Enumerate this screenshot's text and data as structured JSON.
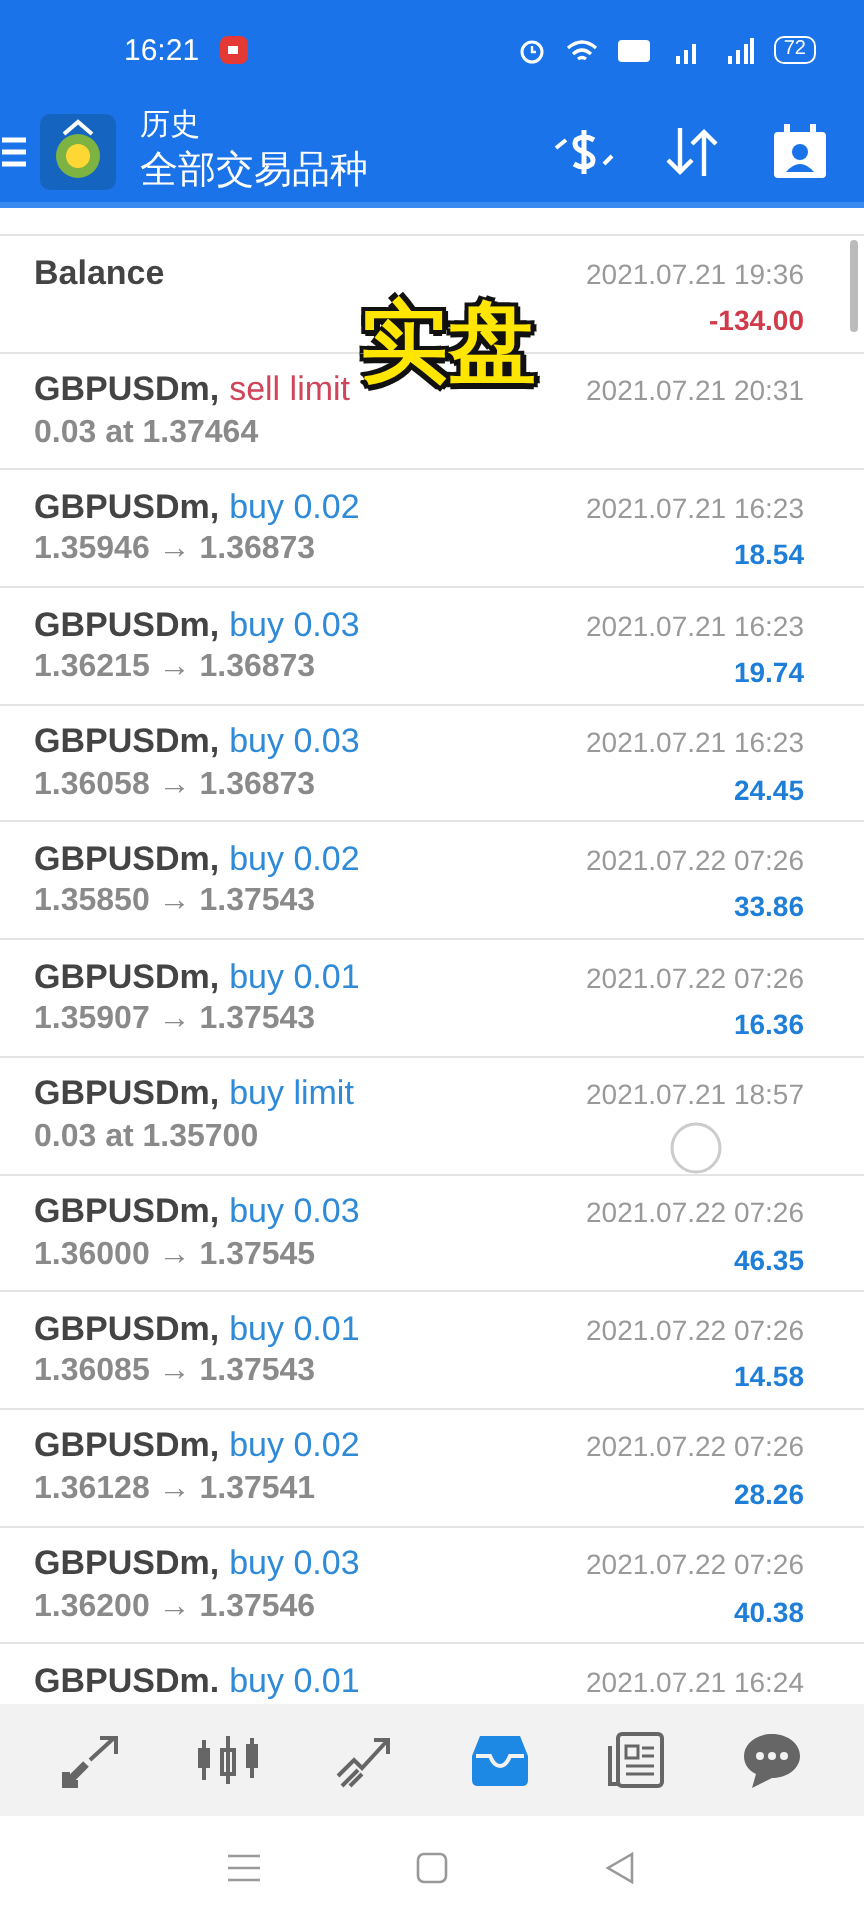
{
  "status_bar": {
    "time": "16:21",
    "battery": "72"
  },
  "app_bar": {
    "title": "历史",
    "subtitle": "全部交易品种"
  },
  "overlay_caption": "实盘",
  "rows": [
    {
      "kind": "balance",
      "symbol": "Balance",
      "date": "2021.07.21 19:36",
      "profit": {
        "text": "-134.00",
        "color": "#d03a4a"
      }
    },
    {
      "kind": "order",
      "symbol": "GBPUSDm,",
      "action": {
        "text": "sell limit",
        "color": "#d0455a"
      },
      "detail": "0.03 at 1.37464",
      "date": "2021.07.21 20:31"
    },
    {
      "kind": "order",
      "symbol": "GBPUSDm,",
      "action": {
        "text": "buy 0.02",
        "color": "#2f8ad8"
      },
      "detail": "1.35946 → 1.36873",
      "date": "2021.07.21 16:23",
      "profit": {
        "text": "18.54",
        "color": "#1f7fd8"
      }
    },
    {
      "kind": "order",
      "symbol": "GBPUSDm,",
      "action": {
        "text": "buy 0.03",
        "color": "#2f8ad8"
      },
      "detail": "1.36215 → 1.36873",
      "date": "2021.07.21 16:23",
      "profit": {
        "text": "19.74",
        "color": "#1f7fd8"
      }
    },
    {
      "kind": "order",
      "symbol": "GBPUSDm,",
      "action": {
        "text": "buy 0.03",
        "color": "#2f8ad8"
      },
      "detail": "1.36058 → 1.36873",
      "date": "2021.07.21 16:23",
      "profit": {
        "text": "24.45",
        "color": "#1f7fd8"
      }
    },
    {
      "kind": "order",
      "symbol": "GBPUSDm,",
      "action": {
        "text": "buy 0.02",
        "color": "#2f8ad8"
      },
      "detail": "1.35850 → 1.37543",
      "date": "2021.07.22 07:26",
      "profit": {
        "text": "33.86",
        "color": "#1f7fd8"
      }
    },
    {
      "kind": "order",
      "symbol": "GBPUSDm,",
      "action": {
        "text": "buy 0.01",
        "color": "#2f8ad8"
      },
      "detail": "1.35907 → 1.37543",
      "date": "2021.07.22 07:26",
      "profit": {
        "text": "16.36",
        "color": "#1f7fd8"
      }
    },
    {
      "kind": "order",
      "symbol": "GBPUSDm,",
      "action": {
        "text": "buy limit",
        "color": "#2f8ad8"
      },
      "detail": "0.03 at 1.35700",
      "date": "2021.07.21 18:57",
      "loading": true
    },
    {
      "kind": "order",
      "symbol": "GBPUSDm,",
      "action": {
        "text": "buy 0.03",
        "color": "#2f8ad8"
      },
      "detail": "1.36000 → 1.37545",
      "date": "2021.07.22 07:26",
      "profit": {
        "text": "46.35",
        "color": "#1f7fd8"
      }
    },
    {
      "kind": "order",
      "symbol": "GBPUSDm,",
      "action": {
        "text": "buy 0.01",
        "color": "#2f8ad8"
      },
      "detail": "1.36085 → 1.37543",
      "date": "2021.07.22 07:26",
      "profit": {
        "text": "14.58",
        "color": "#1f7fd8"
      }
    },
    {
      "kind": "order",
      "symbol": "GBPUSDm,",
      "action": {
        "text": "buy 0.02",
        "color": "#2f8ad8"
      },
      "detail": "1.36128 → 1.37541",
      "date": "2021.07.22 07:26",
      "profit": {
        "text": "28.26",
        "color": "#1f7fd8"
      }
    },
    {
      "kind": "order",
      "symbol": "GBPUSDm,",
      "action": {
        "text": "buy 0.03",
        "color": "#2f8ad8"
      },
      "detail": "1.36200 → 1.37546",
      "date": "2021.07.22 07:26",
      "profit": {
        "text": "40.38",
        "color": "#1f7fd8"
      }
    },
    {
      "kind": "order",
      "symbol": "GBPUSDm.",
      "action": {
        "text": "buy 0.01",
        "color": "#2f8ad8"
      },
      "date": "2021.07.21 16:24"
    }
  ],
  "bottom_nav": [
    {
      "kind": "quotes",
      "selected": false
    },
    {
      "kind": "chart",
      "selected": false
    },
    {
      "kind": "trade",
      "selected": false
    },
    {
      "kind": "history",
      "selected": true
    },
    {
      "kind": "news",
      "selected": false
    },
    {
      "kind": "chat",
      "selected": false
    }
  ]
}
